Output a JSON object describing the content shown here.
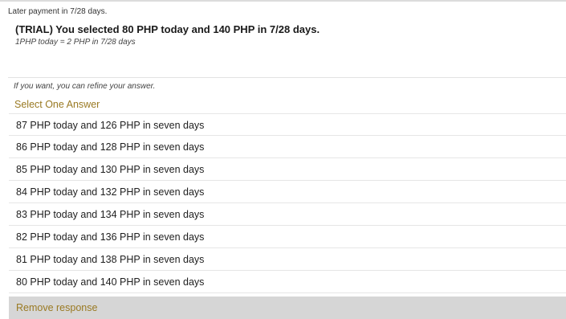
{
  "header": {
    "subheader": "Later payment in 7/28 days.",
    "title": "(TRIAL) You selected 80 PHP today and 140 PHP in 7/28 days.",
    "rate_note": "1PHP today = 2 PHP in 7/28 days"
  },
  "refine": {
    "hint": "If you want, you can refine your answer.",
    "select_label": "Select One Answer"
  },
  "options": [
    "87 PHP today and 126 PHP in seven days",
    "86 PHP today and 128 PHP in seven days",
    "85 PHP today and 130 PHP in seven days",
    "84 PHP today and 132 PHP in seven days",
    "83 PHP today and 134 PHP in seven days",
    "82 PHP today and 136 PHP in seven days",
    "81 PHP today and 138 PHP in seven days",
    "80 PHP today and 140 PHP in seven days"
  ],
  "remove_label": "Remove response",
  "colors": {
    "accent": "#9a7a23",
    "remove_bg": "#d6d6d6"
  }
}
